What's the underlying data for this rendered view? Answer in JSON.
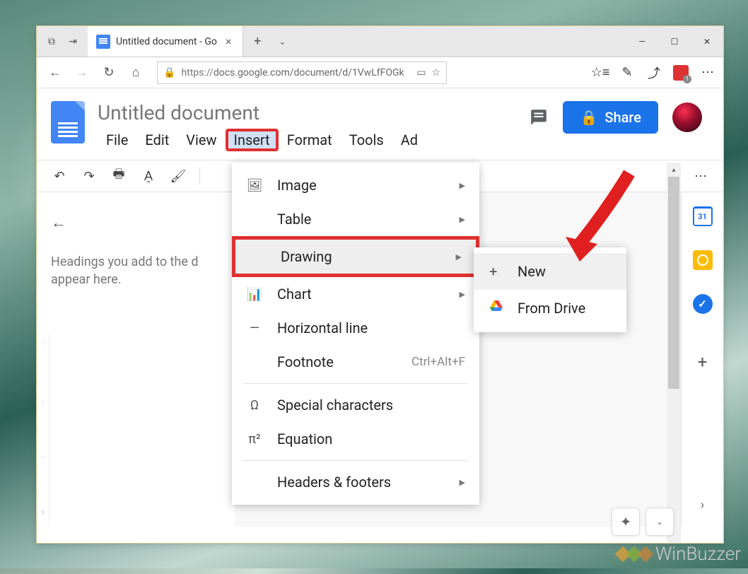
{
  "browser": {
    "tab_title": "Untitled document - Go",
    "url_prefix": "https://",
    "url_rest": "docs.google.com/document/d/1VwLfFOGk",
    "badge_count": "1"
  },
  "doc": {
    "title": "Untitled document",
    "menu": {
      "file": "File",
      "edit": "Edit",
      "view": "View",
      "insert": "Insert",
      "format": "Format",
      "tools": "Tools",
      "addons": "Ad"
    },
    "share_label": "Share",
    "outline_hint_1": "Headings you add to the d",
    "outline_hint_2": "appear here.",
    "ruler_excerpt": "| · · · | · · · 1 · · · |",
    "calendar_date": "31"
  },
  "insert_menu": {
    "image": "Image",
    "table": "Table",
    "drawing": "Drawing",
    "chart": "Chart",
    "hline": "Horizontal line",
    "footnote": "Footnote",
    "footnote_shortcut": "Ctrl+Alt+F",
    "special": "Special characters",
    "equation": "Equation",
    "headers": "Headers & footers"
  },
  "drawing_submenu": {
    "new": "New",
    "from_drive": "From Drive"
  },
  "watermark": "WinBuzzer"
}
